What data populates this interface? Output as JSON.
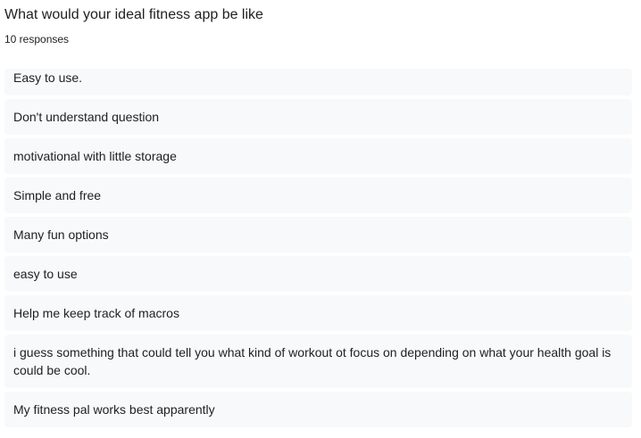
{
  "question": {
    "title": "What would your ideal fitness app be like",
    "response_count": "10 responses"
  },
  "responses": [
    "Easy to use.",
    "Don't understand question",
    "motivational with little storage",
    "Simple and free",
    "Many fun options",
    "easy to use",
    "Help me keep track of macros",
    "i guess something that could tell you what kind of workout ot focus on depending on what your health goal is could be cool.",
    "My fitness pal works best apparently"
  ],
  "colors": {
    "card_background": "#f8f9fa",
    "text": "#202124"
  }
}
